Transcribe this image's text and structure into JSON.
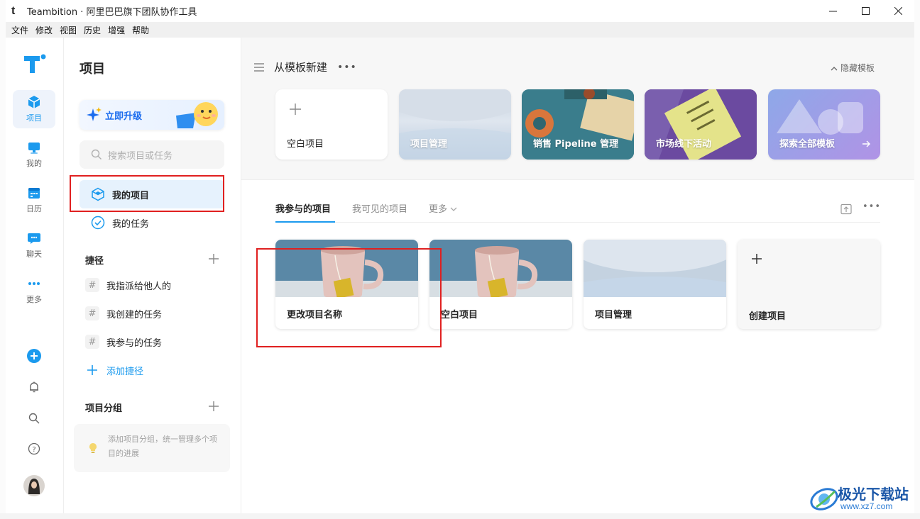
{
  "window": {
    "logo_letter": "t",
    "title": "Teambition · 阿里巴巴旗下团队协作工具",
    "menu": [
      "文件",
      "修改",
      "视图",
      "历史",
      "增强",
      "帮助"
    ]
  },
  "rail": {
    "items": [
      {
        "label": "项目",
        "icon": "cube-icon",
        "active": true
      },
      {
        "label": "我的",
        "icon": "monitor-icon"
      },
      {
        "label": "日历",
        "icon": "calendar-icon"
      },
      {
        "label": "聊天",
        "icon": "chat-icon"
      },
      {
        "label": "更多",
        "icon": "more-dots-icon"
      }
    ]
  },
  "sidebar": {
    "title": "项目",
    "upgrade_label": "立即升级",
    "search_placeholder": "搜索项目或任务",
    "nav": [
      {
        "label": "我的项目",
        "active": true
      },
      {
        "label": "我的任务"
      }
    ],
    "shortcuts_title": "捷径",
    "shortcuts": [
      "我指派给他人的",
      "我创建的任务",
      "我参与的任务"
    ],
    "add_shortcut": "添加捷径",
    "groups_title": "项目分组",
    "groups_tip": "添加项目分组，统一管理多个项目的进展"
  },
  "templates": {
    "heading": "从模板新建",
    "hide_label": "隐藏模板",
    "items": [
      "空白项目",
      "项目管理",
      "销售 Pipeline 管理",
      "市场线下活动",
      "探索全部模板"
    ]
  },
  "tabs": {
    "items": [
      "我参与的项目",
      "我可见的项目"
    ],
    "more": "更多"
  },
  "projects": {
    "items": [
      "更改项目名称",
      "空白项目",
      "项目管理"
    ],
    "create_label": "创建项目"
  },
  "watermark": {
    "title": "极光下载站",
    "url": "www.xz7.com"
  },
  "colors": {
    "accent": "#1b9aee",
    "highlight_box": "#e02020"
  }
}
